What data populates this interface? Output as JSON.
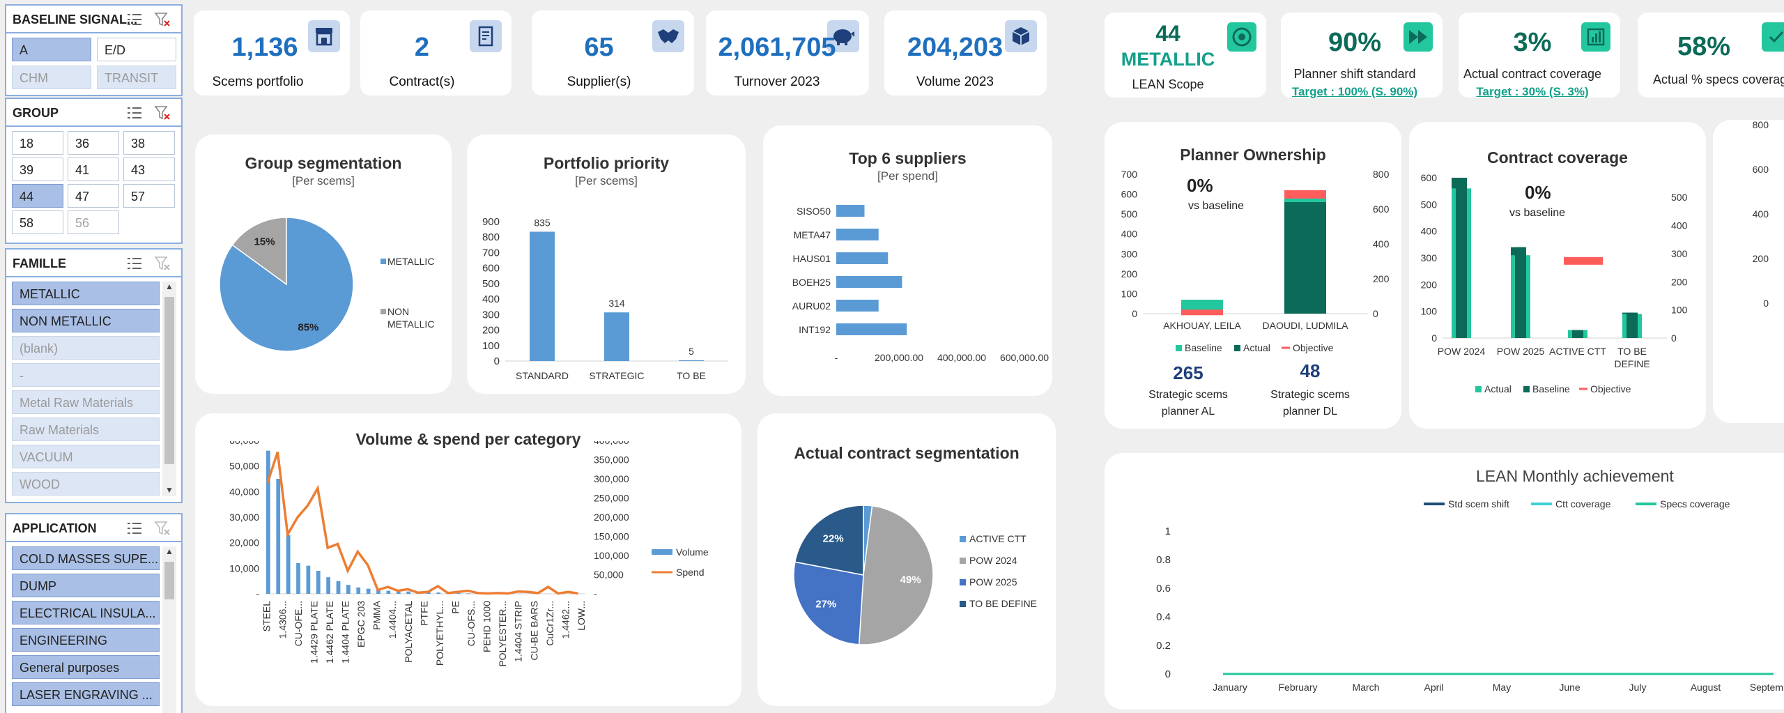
{
  "slicers": {
    "baseline": {
      "title": "BASELINE SIGNAL...",
      "items": [
        "A",
        "E/D",
        "CHM",
        "TRANSIT"
      ]
    },
    "group": {
      "title": "GROUP",
      "items": [
        "18",
        "36",
        "38",
        "39",
        "41",
        "43",
        "44",
        "47",
        "57",
        "58",
        "56"
      ]
    },
    "famille": {
      "title": "FAMILLE",
      "items": [
        "METALLIC",
        "NON METALLIC",
        "(blank)",
        "-",
        "Metal Raw Materials",
        "Raw Materials",
        "VACUUM",
        "WOOD"
      ]
    },
    "application": {
      "title": "APPLICATION",
      "items": [
        "COLD MASSES SUPE...",
        "DUMP",
        "ELECTRICAL INSULA...",
        "ENGINEERING",
        "General purposes",
        "LASER ENGRAVING ..."
      ]
    }
  },
  "kpis": [
    {
      "value": "1,136",
      "label": "Scems portfolio",
      "icon": "store-icon"
    },
    {
      "value": "2",
      "label": "Contract(s)",
      "icon": "contract-icon"
    },
    {
      "value": "65",
      "label": "Supplier(s)",
      "icon": "handshake-icon"
    },
    {
      "value": "2,061,705",
      "label": "Turnover 2023",
      "icon": "piggy-bank-icon"
    },
    {
      "value": "204,203",
      "label": "Volume 2023",
      "icon": "box-icon"
    }
  ],
  "lean_kpis": [
    {
      "value": "44",
      "value2": "METALLIC",
      "label": "LEAN Scope",
      "icon": "aperture-icon"
    },
    {
      "value": "90%",
      "label": "Planner shift standard",
      "target": "Target : 100% (S. 90%)",
      "icon": "fast-forward-icon"
    },
    {
      "value": "3%",
      "label": "Actual contract coverage",
      "target": "Target : 30% (S. 3%)",
      "icon": "bar-chart-icon"
    },
    {
      "value": "58%",
      "label": "Actual % specs coverag",
      "icon": "check-icon"
    }
  ],
  "planner": {
    "pct": "0%",
    "vs": "vs baseline",
    "strat1_value": "265",
    "strat1_label": "Strategic scems planner AL",
    "strat2_value": "48",
    "strat2_label": "Strategic scems planner DL"
  },
  "contract_cov": {
    "pct": "0%",
    "vs": "vs baseline"
  },
  "colors": {
    "blue": "#5b9bd5",
    "gray": "#a5a5a5",
    "orange": "#ed7d31",
    "teal": "#23c79e",
    "dark_teal": "#0b6b58",
    "red": "#ff5c5c",
    "navy": "#1f4e79"
  },
  "chart_data": [
    {
      "type": "pie",
      "title": "Group segmentation",
      "subtitle": "[Per scems]",
      "labels": [
        "METALLIC",
        "NON METALLIC"
      ],
      "values": [
        85,
        15
      ],
      "value_labels": [
        "85%",
        "15%"
      ],
      "legend": "right"
    },
    {
      "type": "bar",
      "title": "Portfolio priority",
      "subtitle": "[Per scems]",
      "categories": [
        "STANDARD",
        "STRATEGIC",
        "TO BE CLASSIFIED"
      ],
      "values": [
        835,
        314,
        5
      ],
      "ylim": [
        0,
        900
      ],
      "yticks": [
        "0",
        "100",
        "200",
        "300",
        "400",
        "500",
        "600",
        "700",
        "800",
        "900"
      ]
    },
    {
      "type": "bar",
      "orientation": "horizontal",
      "title": "Top 6 suppliers",
      "subtitle": "[Per spend]",
      "categories": [
        "SISO50",
        "META47",
        "HAUS01",
        "BOEH25",
        "AURU02",
        "INT192"
      ],
      "values": [
        90000,
        135000,
        165000,
        210000,
        135000,
        225000
      ],
      "xlim": [
        0,
        600000
      ],
      "xticks": [
        "-",
        "200,000.00",
        "400,000.00",
        "600,000.00"
      ]
    },
    {
      "type": "bar",
      "title": "Volume & spend per category",
      "categories": [
        "STEEL",
        "1.4306...",
        "CU-OFE...",
        "1.4429 PLATE",
        "1.4462 PLATE",
        "1.4404 PLATE",
        "EPGC 203",
        "PMMA",
        "1.4404...",
        "POLYACETAL",
        "PTFE",
        "POLYETHYL...",
        "PE",
        "CU-OFS...",
        "PEHD 1000",
        "POLYESTER...",
        "1.4404 STRIP",
        "CU-BE BARS",
        "CuCr1Zr...",
        "1.4462...",
        "LOW..."
      ],
      "series": [
        {
          "name": "Volume",
          "type": "bar",
          "values": [
            56000,
            45000,
            23000,
            12000,
            11000,
            9000,
            6500,
            5000,
            3500,
            2500,
            2000,
            1500,
            1200,
            1000,
            900,
            700,
            600,
            500,
            400,
            300,
            200,
            150,
            120,
            100,
            80,
            60,
            50,
            40,
            30,
            20
          ]
        },
        {
          "name": "Spend",
          "type": "line",
          "axis": "right",
          "values": [
            290000,
            370000,
            155000,
            200000,
            230000,
            275000,
            120000,
            130000,
            60000,
            110000,
            75000,
            10000,
            18000,
            8000,
            12000,
            3000,
            5000,
            20000,
            2000,
            5000,
            8000,
            2000,
            1000,
            2000,
            1000,
            6000,
            5000,
            2000,
            18000,
            1000,
            5000,
            1000
          ]
        }
      ],
      "yticks_left": [
        "-",
        "10,000",
        "20,000",
        "30,000",
        "40,000",
        "50,000",
        "60,000"
      ],
      "yticks_right": [
        "-",
        "50,000",
        "100,000",
        "150,000",
        "200,000",
        "250,000",
        "300,000",
        "350,000",
        "400,000"
      ],
      "legend": "right"
    },
    {
      "type": "pie",
      "title": "Actual contract segmentation",
      "labels": [
        "ACTIVE CTT",
        "POW 2024",
        "POW 2025",
        "TO BE DEFINE"
      ],
      "values": [
        2,
        49,
        27,
        22
      ],
      "value_labels": [
        "",
        "49%",
        "27%",
        "22%"
      ],
      "legend": "right"
    },
    {
      "type": "bar",
      "title": "Planner Ownership",
      "categories": [
        "AKHOUAY, LEILA",
        "DAOUDI, LUDMILA"
      ],
      "series": [
        {
          "name": "Baseline",
          "values": [
            70,
            610
          ]
        },
        {
          "name": "Actual",
          "values": [
            60,
            580
          ]
        },
        {
          "name": "Objective",
          "values": [
            20,
            600
          ]
        }
      ],
      "yticks_left": [
        "0",
        "100",
        "200",
        "300",
        "400",
        "500",
        "600",
        "700"
      ],
      "yticks_right": [
        "0",
        "200",
        "400",
        "600",
        "800"
      ]
    },
    {
      "type": "bar",
      "title": "Contract coverage",
      "categories": [
        "POW 2024",
        "POW 2025",
        "ACTIVE CTT",
        "TO BE DEFINE"
      ],
      "series": [
        {
          "name": "Actual",
          "values": [
            560,
            310,
            30,
            90
          ]
        },
        {
          "name": "Baseline",
          "values": [
            600,
            340,
            30,
            95
          ]
        },
        {
          "name": "Objective",
          "values": [
            null,
            null,
            290,
            null
          ]
        }
      ],
      "yticks_left": [
        "0",
        "100",
        "200",
        "300",
        "400",
        "500",
        "600"
      ],
      "yticks_right": [
        "0",
        "100",
        "200",
        "300",
        "400",
        "500"
      ]
    },
    {
      "type": "line",
      "title": "LEAN Monthly achievement",
      "categories": [
        "January",
        "February",
        "March",
        "April",
        "May",
        "June",
        "July",
        "August",
        "September"
      ],
      "series": [
        {
          "name": "Std scem shift",
          "values": [
            0,
            0,
            0,
            0,
            0,
            0,
            0,
            0,
            0
          ]
        },
        {
          "name": "Ctt coverage",
          "values": [
            0,
            0,
            0,
            0,
            0,
            0,
            0,
            0,
            0
          ]
        },
        {
          "name": "Specs coverage",
          "values": [
            0,
            0,
            0,
            0,
            0,
            0,
            0,
            0,
            0
          ]
        }
      ],
      "yticks": [
        "0",
        "0.2",
        "0.4",
        "0.6",
        "0.8",
        "1"
      ],
      "ylim": [
        0,
        1
      ],
      "legend": "top"
    },
    {
      "type": "bar",
      "title": "",
      "yticks": [
        "0",
        "200",
        "400",
        "600",
        "800"
      ]
    }
  ]
}
